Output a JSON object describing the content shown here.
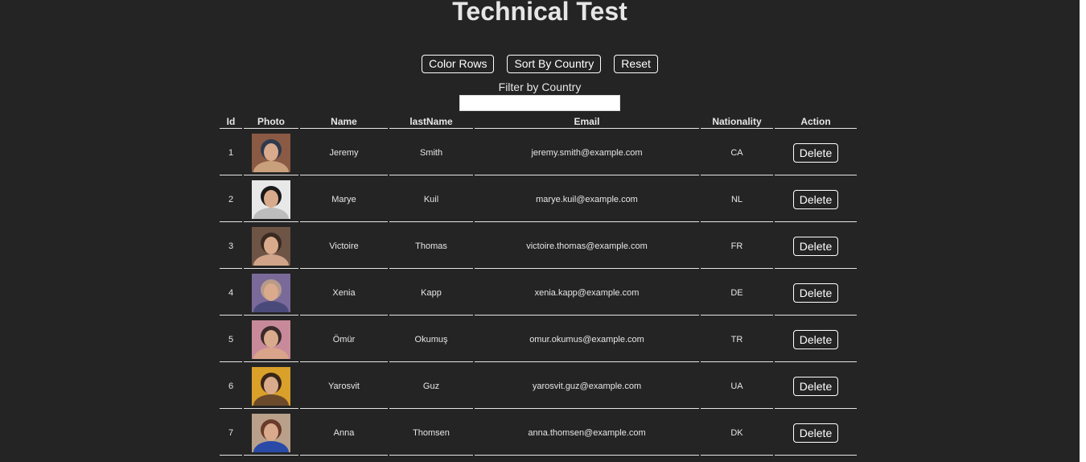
{
  "title": "Technical Test",
  "toolbar": {
    "color_rows_label": "Color Rows",
    "sort_by_country_label": "Sort By Country",
    "reset_label": "Reset"
  },
  "filter": {
    "label": "Filter by Country",
    "value": ""
  },
  "table": {
    "columns": [
      "Id",
      "Photo",
      "Name",
      "lastName",
      "Email",
      "Nationality",
      "Action"
    ],
    "delete_label": "Delete",
    "rows": [
      {
        "id": "1",
        "name": "Jeremy",
        "last_name": "Smith",
        "email": "jeremy.smith@example.com",
        "nationality": "CA",
        "photo_colors": [
          "#8a5a44",
          "#2e3a4e",
          "#c9a07c"
        ]
      },
      {
        "id": "2",
        "name": "Marye",
        "last_name": "Kuil",
        "email": "marye.kuil@example.com",
        "nationality": "NL",
        "photo_colors": [
          "#e8e8e8",
          "#1a1a1a",
          "#bdbdbd"
        ]
      },
      {
        "id": "3",
        "name": "Victoire",
        "last_name": "Thomas",
        "email": "victoire.thomas@example.com",
        "nationality": "FR",
        "photo_colors": [
          "#6e5444",
          "#3a2a22",
          "#d1a48a"
        ]
      },
      {
        "id": "4",
        "name": "Xenia",
        "last_name": "Kapp",
        "email": "xenia.kapp@example.com",
        "nationality": "DE",
        "photo_colors": [
          "#7a6a9a",
          "#b89a8a",
          "#4a4a7a"
        ]
      },
      {
        "id": "5",
        "name": "Ömür",
        "last_name": "Okumuş",
        "email": "omur.okumus@example.com",
        "nationality": "TR",
        "photo_colors": [
          "#c88a9a",
          "#3a2a2a",
          "#d9a48a"
        ]
      },
      {
        "id": "6",
        "name": "Yarosvit",
        "last_name": "Guz",
        "email": "yarosvit.guz@example.com",
        "nationality": "UA",
        "photo_colors": [
          "#d9a02a",
          "#3a2618",
          "#6a4a2a"
        ]
      },
      {
        "id": "7",
        "name": "Anna",
        "last_name": "Thomsen",
        "email": "anna.thomsen@example.com",
        "nationality": "DK",
        "photo_colors": [
          "#b8a08a",
          "#6a3a2a",
          "#2a4aa8"
        ]
      }
    ]
  }
}
